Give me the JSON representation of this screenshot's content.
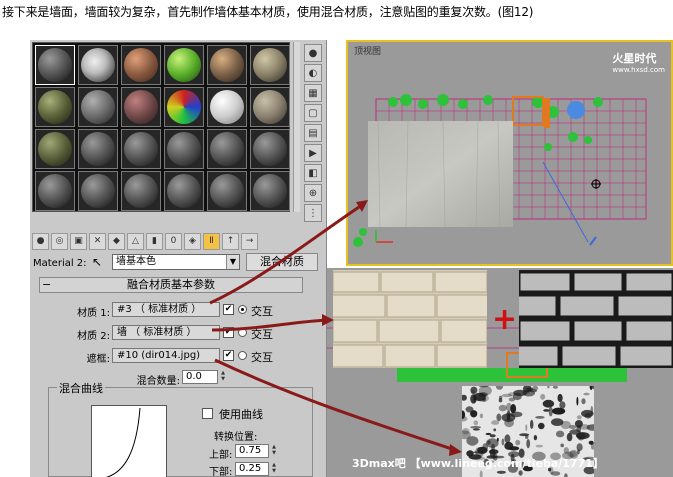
{
  "caption": "接下来是墙面，墙面较为复杂，首先制作墙体基本材质，使用混合材质，注意贴图的重复次数。(图12)",
  "material_editor": {
    "material_label": "Material 2:",
    "material_name": "墙基本色",
    "material_type": "混合材质",
    "rollout_title": "融合材质基本参数",
    "params": [
      {
        "label": "材质 1:",
        "value": "#3 （ 标准材质 ）",
        "checked": true,
        "radio_on": true,
        "interactive_label": "交互"
      },
      {
        "label": "材质 2:",
        "value": "墙 （ 标准材质 ）",
        "checked": true,
        "radio_on": false,
        "interactive_label": "交互"
      },
      {
        "label": "遮框:",
        "value": "#10 (dir014.jpg)",
        "checked": true,
        "radio_on": false,
        "interactive_label": "交互"
      }
    ],
    "mix_amount_label": "混合数量:",
    "mix_amount_value": "0.0",
    "curve_group_label": "混合曲线",
    "use_curve_label": "使用曲线",
    "transition_label": "转换位置:",
    "upper_label": "上部:",
    "upper_value": "0.75",
    "lower_label": "下部:",
    "lower_value": "0.25"
  },
  "viewport_top": {
    "label": "顶视图"
  },
  "watermark": {
    "title": "火星时代",
    "url": "www.hxsd.com"
  },
  "bottom_watermark": "3Dmax吧 【www.lineeg.com/tieba/1771】",
  "plus_sign": "+"
}
